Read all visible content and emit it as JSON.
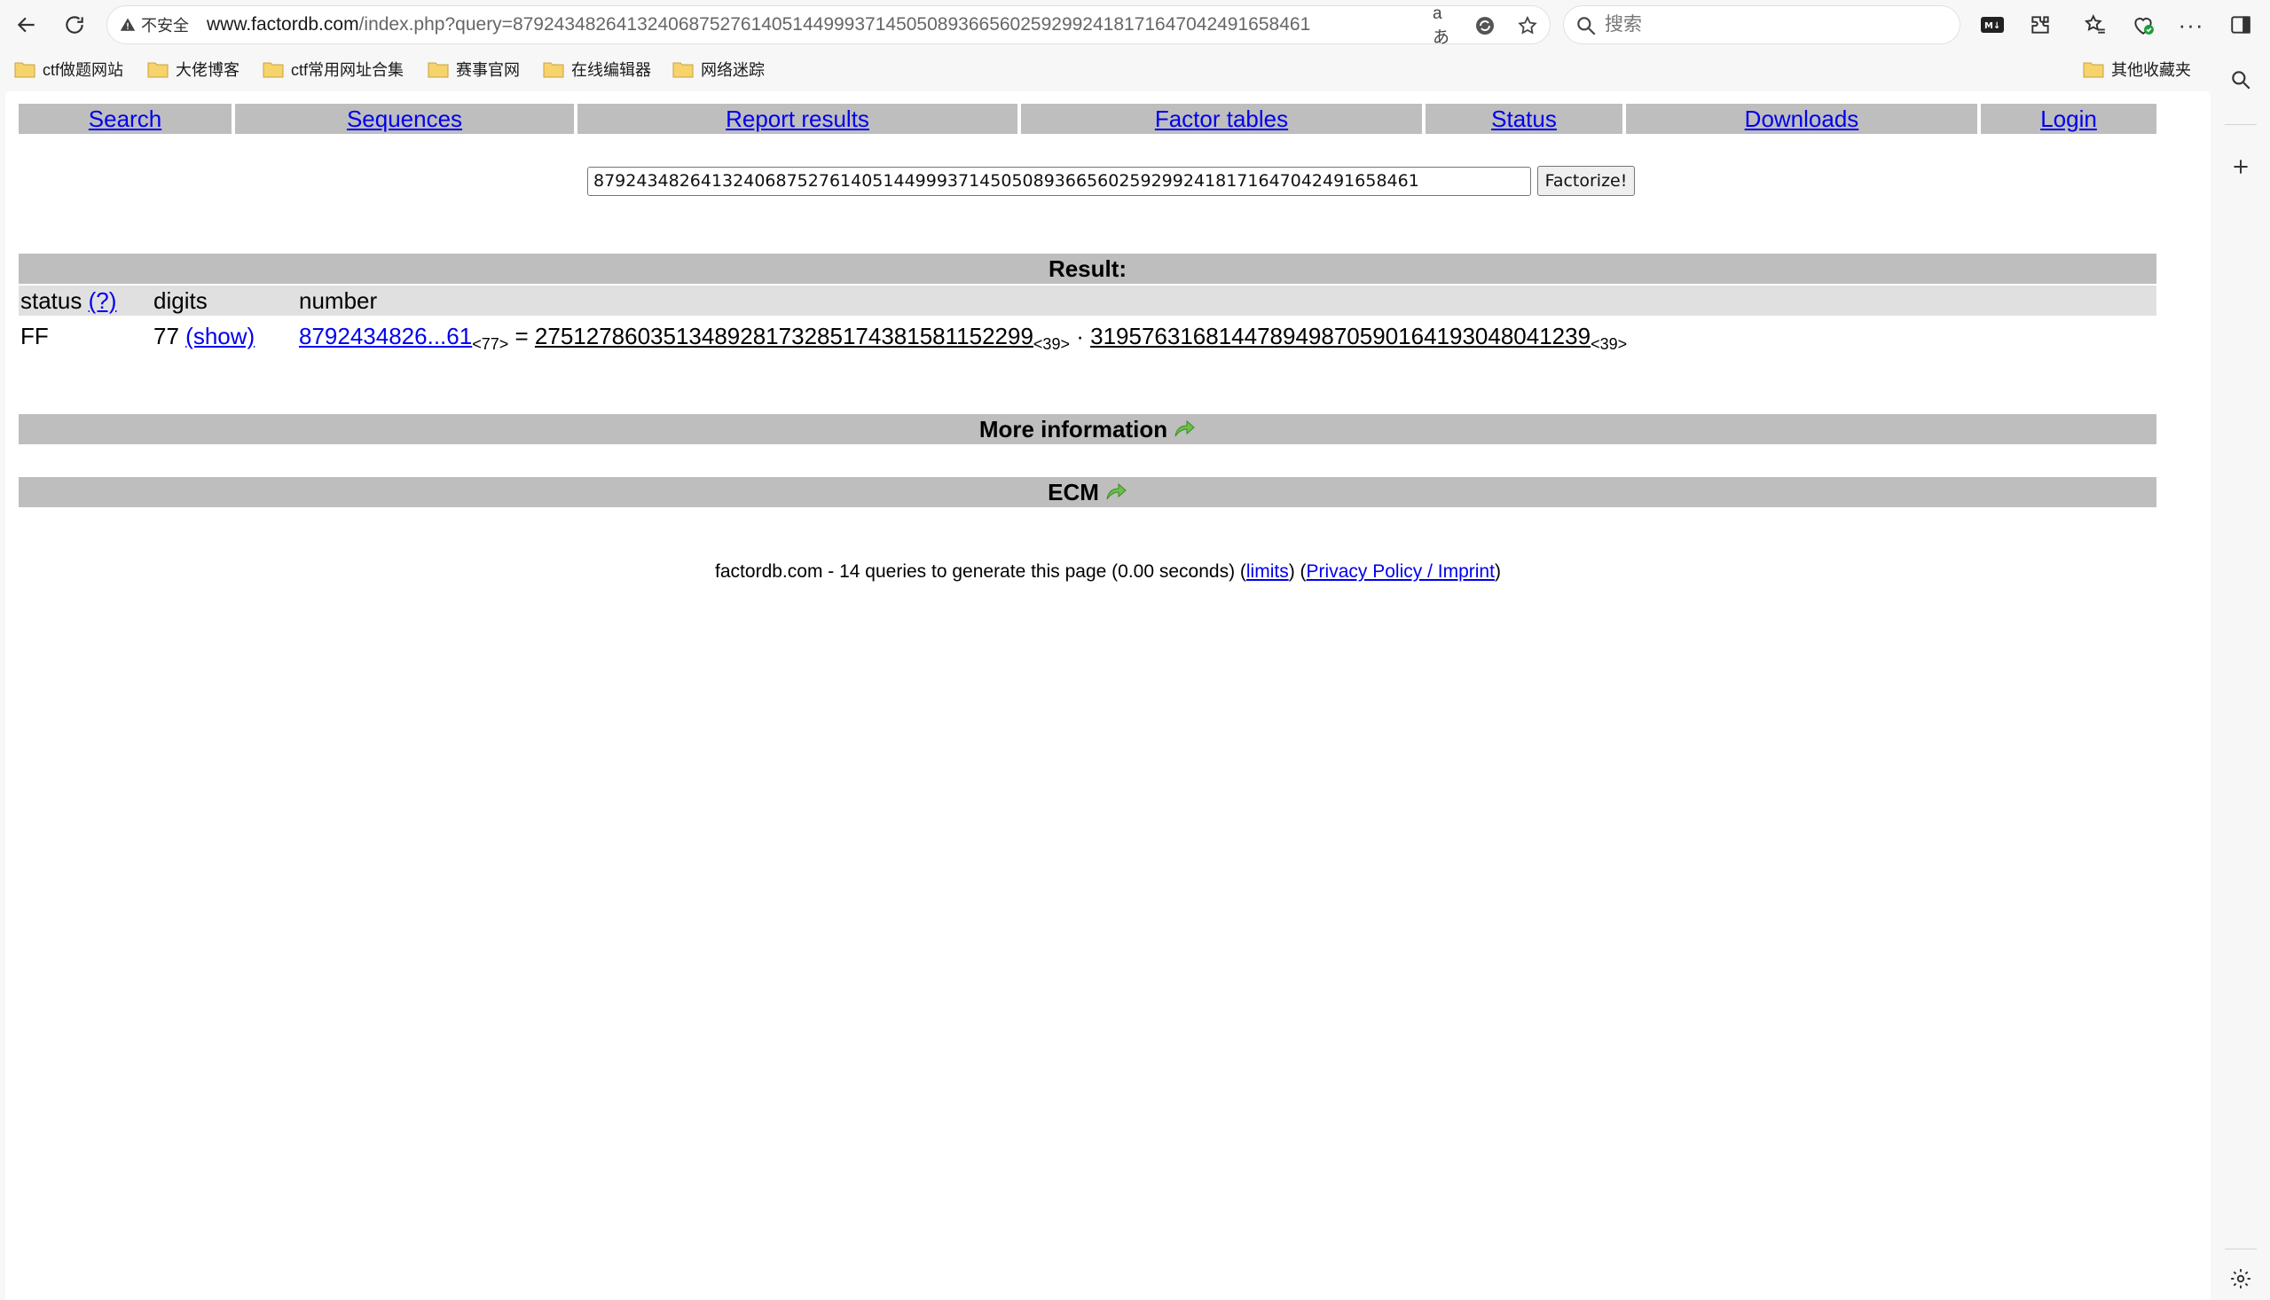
{
  "browser": {
    "insecure_label": "不安全",
    "url_host": "www.factordb.com",
    "url_path": "/index.php?query=87924348264132406875276140514499937145050893665602592992418171647042491658461",
    "search_placeholder": "搜索"
  },
  "bookmarks": {
    "items": [
      "ctf做题网站",
      "大佬博客",
      "ctf常用网址合集",
      "赛事官网",
      "在线编辑器",
      "网络迷踪"
    ],
    "other": "其他收藏夹"
  },
  "nav": {
    "items": [
      "Search",
      "Sequences",
      "Report results",
      "Factor tables",
      "Status",
      "Downloads",
      "Login"
    ]
  },
  "query": {
    "value": "87924348264132406875276140514499937145050893665602592992418171647042491658461",
    "button": "Factorize!"
  },
  "result": {
    "title": "Result:",
    "headers": {
      "status": "status",
      "status_help": "(?)",
      "digits": "digits",
      "number": "number"
    },
    "row": {
      "status": "FF",
      "digits": "77",
      "show": "(show)",
      "number_short": "8792434826...61",
      "number_digits": "<77>",
      "equals": "=",
      "factor1": "275127860351348928173285174381581152299",
      "factor1_digits": "<39>",
      "dot": "·",
      "factor2": "319576316814478949870590164193048041239",
      "factor2_digits": "<39>"
    }
  },
  "sections": {
    "more_info": "More information",
    "ecm": "ECM"
  },
  "footer": {
    "prefix": "factordb.com - 14 queries to generate this page (0.00 seconds) (",
    "limits": "limits",
    "middle": ") (",
    "privacy": "Privacy Policy / Imprint",
    "suffix": ")"
  },
  "colors": {
    "bar_gray": "#bebebe",
    "header_gray": "#e0e0e0",
    "link_blue": "#0000ee",
    "arrow_green": "#5cb85c"
  }
}
